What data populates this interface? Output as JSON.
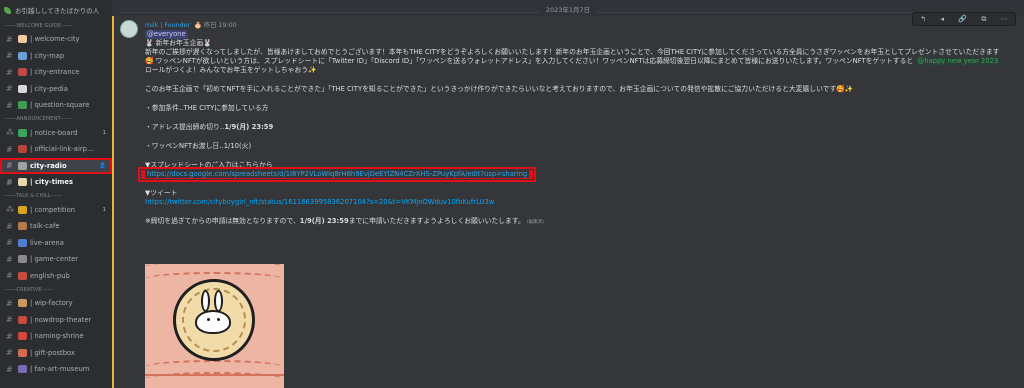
{
  "server": {
    "name": "お引越ししてきたばかりの人"
  },
  "sidebar": {
    "categories": [
      {
        "label": "------WELCOME GUIDE------",
        "channels": [
          {
            "hash": "#",
            "label": "| welcome-city",
            "emoji_color": "#f2c9a0"
          },
          {
            "hash": "#",
            "label": "| city-map",
            "emoji_color": "#6aa0d8"
          },
          {
            "hash": "#",
            "label": "| city-entrance",
            "emoji_color": "#c04848"
          },
          {
            "hash": "#",
            "label": "| city-pedia",
            "emoji_color": "#d8d8d8"
          },
          {
            "hash": "#",
            "label": "| question-square",
            "emoji_color": "#3e9d54"
          }
        ]
      },
      {
        "label": "------ANNOUNCEMENT------",
        "channels": [
          {
            "hash": "⁂",
            "label": "| notice-board",
            "emoji_color": "#3ba55c",
            "badge": "1"
          },
          {
            "hash": "#",
            "label": "| official-link-airp...",
            "emoji_color": "#b8453a"
          },
          {
            "hash": "#",
            "label": "city-radio",
            "emoji_color": "#a0a0a0",
            "active": true,
            "badge": "👤"
          },
          {
            "hash": "#",
            "label": "| city-times",
            "emoji_color": "#e8d7a8",
            "bold": true
          }
        ]
      },
      {
        "label": "------TALK & CHILL------",
        "channels": [
          {
            "hash": "⁂",
            "label": "| competition",
            "emoji_color": "#d8a420",
            "badge": "1"
          },
          {
            "hash": "#",
            "label": "talk-cafe",
            "emoji_color": "#b47a4b"
          },
          {
            "hash": "#",
            "label": "live-arena",
            "emoji_color": "#4f7fd0"
          },
          {
            "hash": "#",
            "label": "| game-center",
            "emoji_color": "#8a8a8a"
          },
          {
            "hash": "#",
            "label": "english-pub",
            "emoji_color": "#c44d3c"
          }
        ]
      },
      {
        "label": "------CREATIVE------",
        "channels": [
          {
            "hash": "#",
            "label": "| wip-factory",
            "emoji_color": "#c99a5e"
          },
          {
            "hash": "#",
            "label": "| nowdrop-theater",
            "emoji_color": "#c44d3c"
          },
          {
            "hash": "#",
            "label": "| naming-shrine",
            "emoji_color": "#d8453a"
          },
          {
            "hash": "#",
            "label": "| gift-postbox",
            "emoji_color": "#d36b4f"
          },
          {
            "hash": "#",
            "label": "| fan-art-museum",
            "emoji_color": "#7a6ab2"
          }
        ]
      }
    ]
  },
  "main": {
    "date": "2023年1月7日",
    "message": {
      "author": "milk | Founder",
      "timestamp": "🎂 昨日 19:00",
      "mention": "@everyone",
      "title": "🐰 新年お年玉企画🐰",
      "p1": "新年のご挨拶が遅くなってしましたが、皆様あけましておめでとうございます！本年もTHE CITYをどうぞよろしくお願いいたします！新年のお年玉企画ということで、今回THE CITYに参加してくださっている方全員にうさぎワッペンをお年玉としてプレゼントさせていただきます🥰 ワッペンNFTが欲しいという方は、スプレッドシートに「Twitter ID」「Discord ID」「ワッペンを送るウォレットアドレス」を入力してください！ワッペンNFTは応募締切後翌日以降にまとめて皆様にお送りいたします。ワッペンNFTをゲットすると",
      "role": "@happy new year 2023",
      "p1_end": " ロールがつくよ！みんなでお年玉をゲットしちゃおう✨",
      "p2": "このお年玉企画で「初めてNFTを手に入れることができた」「THE CITYを知ることができた」というきっかけ作りができたらいいなと考えておりますので、お年玉企画についての発信や拡散にご協力いただけると大変嬉しいです🥰✨",
      "cond": "・参加条件‥THE CITYに参加している方",
      "deadline_prefix": "・アドレス提出締め切り‥",
      "deadline": "1/9(月) 23:59",
      "delivery": "・ワッペンNFTお渡し日‥1/10(火)",
      "sheet_label": "▼スプレッドシートのご入力はこちらから",
      "sheet_url": "https://docs.google.com/spreadsheets/d/1I8YP2VLoWlq8rH6h9EvjDeEYlZN4CZrXHS-ZPuyKpfA/edit?usp=sharing",
      "tweet_label": "▼ツイート",
      "tweet_url": "https://twitter.com/cityboygirl_nft/status/1611663995836207104?s=20&t=VKMjnOWduv10fbKufrLU3w",
      "note_prefix": "※締切を過ぎてからの申請は無効となりますので、",
      "note_bold": "1/9(月) 23:59",
      "note_suffix": "までに申請いただきますようよろしくお願いいたします。",
      "edited": "(編集済)"
    },
    "toolbar": [
      "↰",
      "◂",
      "🔗",
      "⧉",
      "⋯"
    ]
  }
}
